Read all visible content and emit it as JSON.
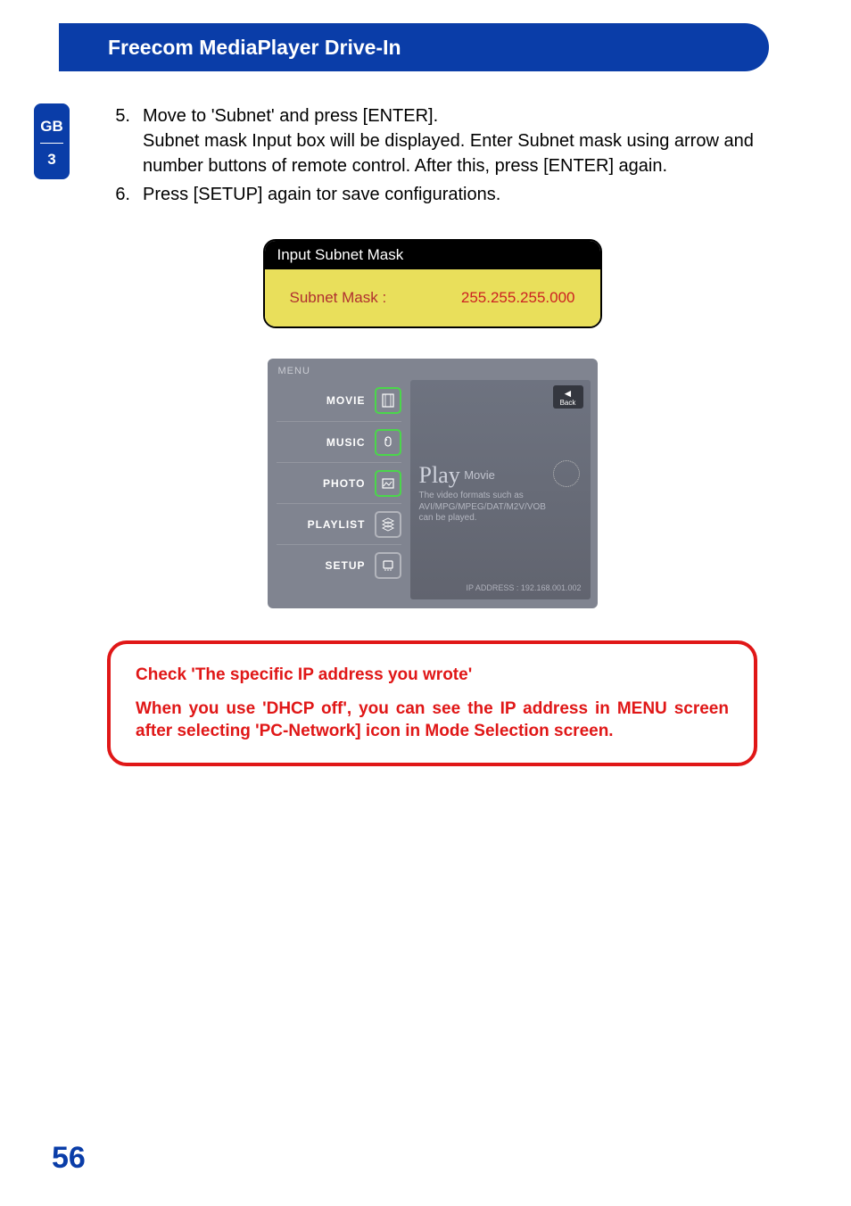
{
  "header": {
    "title": "Freecom MediaPlayer Drive-In"
  },
  "side_tab": {
    "lang": "GB",
    "num": "3"
  },
  "steps": [
    {
      "num": "5.",
      "line1": "Move to 'Subnet' and press [ENTER].",
      "line2": "Subnet mask Input box will be displayed. Enter Subnet mask using arrow and number buttons of remote control. After this, press [ENTER] again."
    },
    {
      "num": "6.",
      "line1": "Press [SETUP] again tor save configurations."
    }
  ],
  "subnet_box": {
    "header": "Input Subnet Mask",
    "label": "Subnet Mask :",
    "value": "255.255.255.000"
  },
  "menu_shot": {
    "menu_label": "MENU",
    "items": [
      {
        "label": "MOVIE",
        "icon": "film-icon"
      },
      {
        "label": "MUSIC",
        "icon": "music-icon"
      },
      {
        "label": "PHOTO",
        "icon": "photo-icon"
      },
      {
        "label": "PLAYLIST",
        "icon": "playlist-icon"
      },
      {
        "label": "SETUP",
        "icon": "setup-icon"
      }
    ],
    "back_label": "Back",
    "play_big": "Play",
    "play_small": "Movie",
    "desc1": "The video formats such as",
    "desc2": "AVI/MPG/MPEG/DAT/M2V/VOB",
    "desc3": "can be played.",
    "ip_label": "IP ADDRESS :",
    "ip_value": "192.168.001.002"
  },
  "callout": {
    "line1": "Check 'The specific IP address you wrote'",
    "line2": "When you use 'DHCP off', you can see the IP address in MENU screen after selecting 'PC-Network] icon in Mode Selection screen."
  },
  "page_number": "56"
}
